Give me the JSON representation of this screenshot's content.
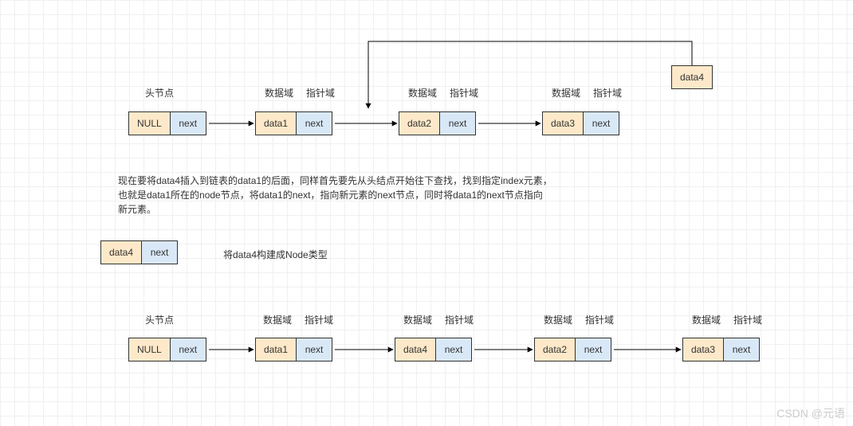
{
  "labels": {
    "head": "头节点",
    "dataField": "数据域",
    "ptrField": "指针域",
    "null": "NULL",
    "next": "next",
    "d1": "data1",
    "d2": "data2",
    "d3": "data3",
    "d4": "data4",
    "buildNote": "将data4构建成Node类型"
  },
  "paragraph": {
    "l1": "现在要将data4插入到链表的data1的后面，同样首先要先从头结点开始往下查找，找到指定index元素，",
    "l2": "也就是data1所在的node节点，将data1的next，指向新元素的next节点，同时将data1的next节点指向",
    "l3": "新元素。"
  },
  "watermark": "CSDN @元语"
}
